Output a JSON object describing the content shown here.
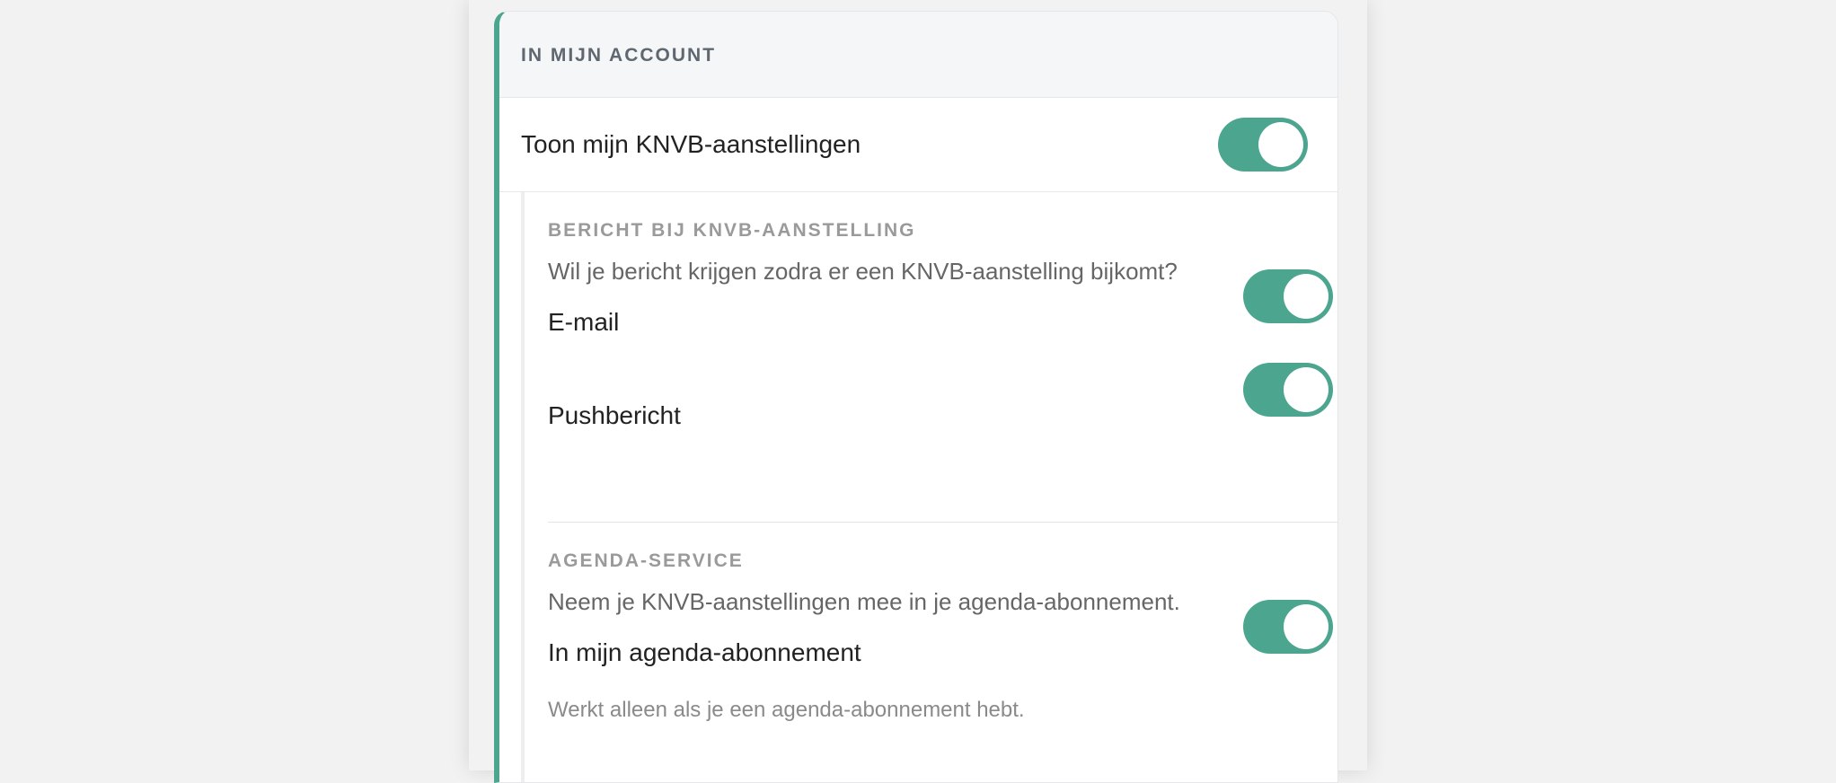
{
  "section": {
    "header_title": "IN MIJN ACCOUNT",
    "show_assignments": {
      "label": "Toon mijn KNVB-aanstellingen",
      "enabled": true
    }
  },
  "notification": {
    "title": "BERICHT BIJ KNVB-AANSTELLING",
    "description": "Wil je bericht krijgen zodra er een KNVB-aanstelling bijkomt?",
    "options": [
      {
        "label": "E-mail",
        "enabled": true
      },
      {
        "label": "Pushbericht",
        "enabled": true
      }
    ]
  },
  "agenda": {
    "title": "AGENDA-SERVICE",
    "description": "Neem je KNVB-aanstellingen mee in je agenda-abonnement.",
    "option": {
      "label": "In mijn agenda-abonnement",
      "enabled": true
    },
    "note": "Werkt alleen als je een agenda-abonnement hebt."
  },
  "colors": {
    "accent": "#4ca58f",
    "page_background": "#f2f2f2",
    "header_background": "#f5f6f7"
  }
}
